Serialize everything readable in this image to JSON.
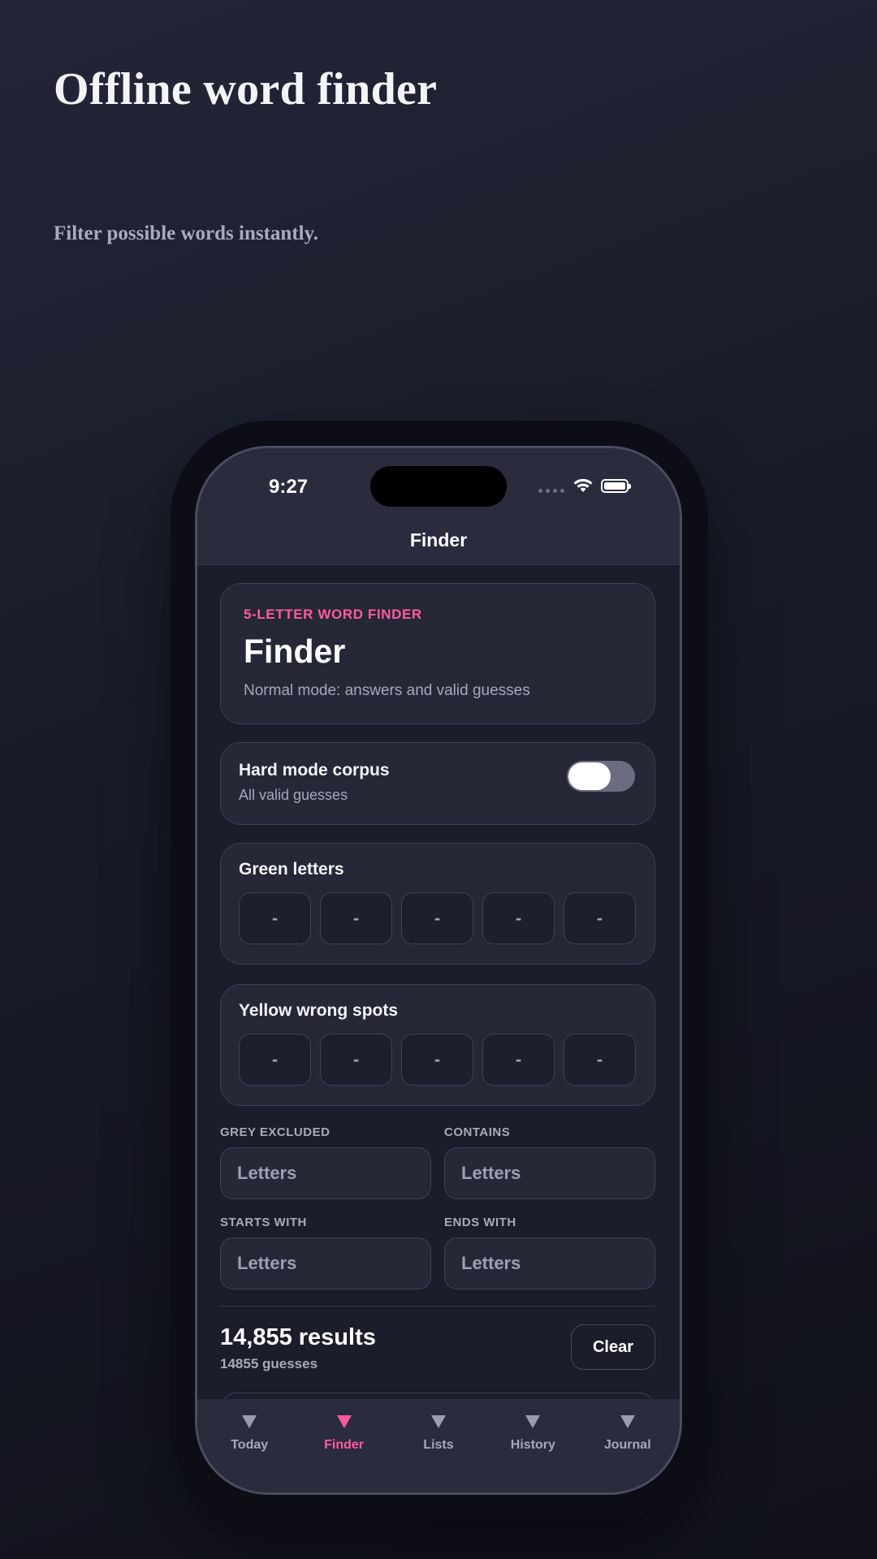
{
  "hero": {
    "title": "Offline word finder",
    "subtitle": "Filter possible words instantly."
  },
  "status_bar": {
    "time": "9:27"
  },
  "nav": {
    "title": "Finder"
  },
  "header_card": {
    "eyebrow": "5-LETTER WORD FINDER",
    "title": "Finder",
    "description": "Normal mode: answers and valid guesses"
  },
  "hard_mode": {
    "title": "Hard mode corpus",
    "subtitle": "All valid guesses",
    "enabled": true
  },
  "green_letters": {
    "title": "Green letters",
    "slots": [
      "-",
      "-",
      "-",
      "-",
      "-"
    ]
  },
  "yellow_letters": {
    "title": "Yellow wrong spots",
    "slots": [
      "-",
      "-",
      "-",
      "-",
      "-"
    ]
  },
  "filters": {
    "grey_excluded": {
      "label": "GREY EXCLUDED",
      "placeholder": "Letters"
    },
    "contains": {
      "label": "CONTAINS",
      "placeholder": "Letters"
    },
    "starts_with": {
      "label": "STARTS WITH",
      "placeholder": "Letters"
    },
    "ends_with": {
      "label": "ENDS WITH",
      "placeholder": "Letters"
    }
  },
  "results": {
    "count": "14,855 results",
    "subtitle": "14855 guesses",
    "clear_label": "Clear"
  },
  "tabs": [
    {
      "label": "Today",
      "active": false
    },
    {
      "label": "Finder",
      "active": true
    },
    {
      "label": "Lists",
      "active": false
    },
    {
      "label": "History",
      "active": false
    },
    {
      "label": "Journal",
      "active": false
    }
  ],
  "colors": {
    "accent": "#ff5c9e",
    "background": "#1c1d2a",
    "card": "#262737"
  }
}
